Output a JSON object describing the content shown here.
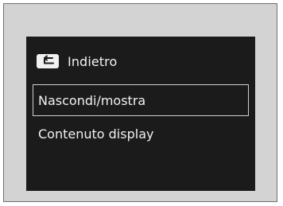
{
  "menu": {
    "back": {
      "icon": "back-arrow-icon",
      "label": "Indietro"
    },
    "items": [
      {
        "label": "Nascondi/mostra",
        "selected": true
      },
      {
        "label": "Contenuto display",
        "selected": false
      }
    ]
  },
  "colors": {
    "screen_background": "#1b1b1b",
    "text": "#f1f1f1",
    "selection_border": "#cfcfcf",
    "frame_background": "#d3d3d3"
  }
}
